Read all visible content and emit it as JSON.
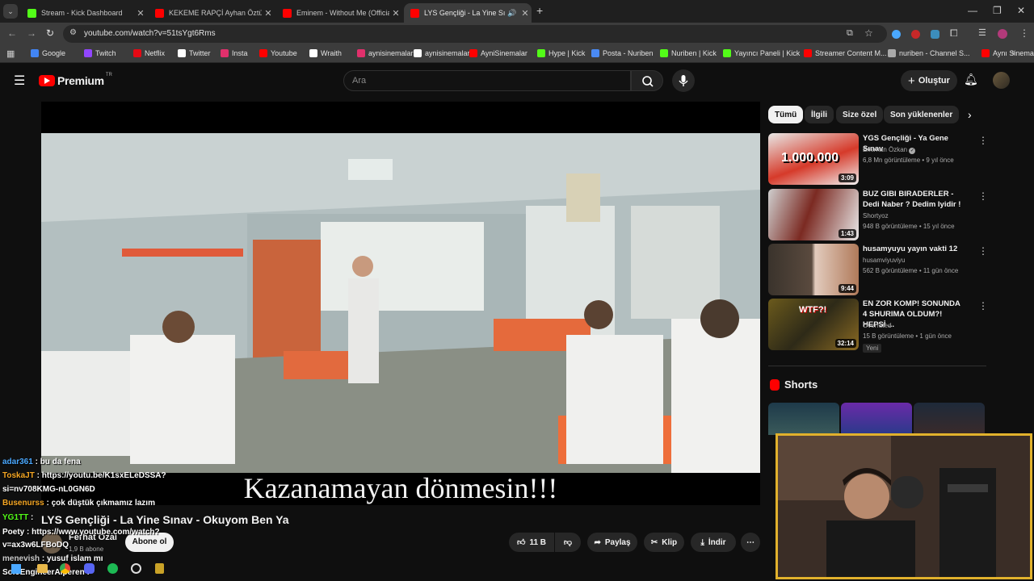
{
  "browser": {
    "tabs": [
      {
        "label": "Stream - Kick Dashboard",
        "icon": "kick-icon"
      },
      {
        "label": "KEKEME RAPÇİ Ayhan Öztürk Yo",
        "icon": "youtube-icon"
      },
      {
        "label": "Eminem - Without Me (Official",
        "icon": "youtube-icon"
      },
      {
        "label": "LYS Gençliği - La Yine Sınav",
        "icon": "youtube-icon"
      }
    ],
    "url": "youtube.com/watch?v=51tsYgt6Rms",
    "bookmarks": [
      {
        "label": "Google",
        "color": "#4285f4"
      },
      {
        "label": "Twitch",
        "color": "#9146ff"
      },
      {
        "label": "Netflix",
        "color": "#e50914"
      },
      {
        "label": "Twitter",
        "color": "#ffffff"
      },
      {
        "label": "Insta",
        "color": "#e1306c"
      },
      {
        "label": "Youtube",
        "color": "#ff0000"
      },
      {
        "label": "Wraith",
        "color": "#ffffff"
      },
      {
        "label": "aynisinemalar",
        "color": "#e1306c"
      },
      {
        "label": "aynisinemalar",
        "color": "#ffffff"
      },
      {
        "label": "AyniSinemalar",
        "color": "#ff0000"
      },
      {
        "label": "Hype | Kick",
        "color": "#53fc18"
      },
      {
        "label": "Posta - Nuriben",
        "color": "#4a8af4"
      },
      {
        "label": "Nuriben | Kick",
        "color": "#53fc18"
      },
      {
        "label": "Yayıncı Paneli | Kick",
        "color": "#53fc18"
      },
      {
        "label": "Streamer Content M...",
        "color": "#ff0000"
      },
      {
        "label": "nuriben - Channel S...",
        "color": "#aaaaaa"
      },
      {
        "label": "Aynı Sinemalar - Ça...",
        "color": "#ff0000"
      }
    ]
  },
  "youtube": {
    "logo": "Premium",
    "logo_tag": "TR",
    "search_placeholder": "Ara",
    "create_label": "Oluştur",
    "chips": [
      "Tümü",
      "İlgili",
      "Size özel",
      "Son yüklenenler"
    ],
    "video": {
      "subtitle": "Kazanamayan dönmesin!!!",
      "title": "LYS Gençliği - La Yine Sınav - Okuyom Ben Ya",
      "channel": "Ferhat Özal",
      "subscribers": "1,9 B abone",
      "subscribe_label": "Abone ol",
      "likes": "11 B",
      "share_label": "Paylaş",
      "clip_label": "Klip",
      "download_label": "İndir"
    },
    "related": [
      {
        "title": "YGS Gençliği - Ya Gene Sınav",
        "channel": "Emirhan Özkan",
        "verified": true,
        "meta": "6,8 Mn görüntüleme • 9 yıl önce",
        "duration": "3:09",
        "thumb_text": "1.000.000"
      },
      {
        "title": "BUZ GIBI BIRADERLER - Dedi Naber ? Dedim Iyidir !",
        "channel": "Shortyoz",
        "verified": false,
        "meta": "948 B görüntüleme • 15 yıl önce",
        "duration": "1:43"
      },
      {
        "title": "husamyuyu yayın vakti 12",
        "channel": "husamviyuviyu",
        "verified": false,
        "meta": "562 B görüntüleme • 11 gün önce",
        "duration": "9:44"
      },
      {
        "title": "EN ZOR KOMP! SONUNDA 4 SHURIMA OLDUM?! HEPSİ ...",
        "channel": "Overrated",
        "verified": false,
        "meta": "15 B görüntüleme • 1 gün önce",
        "duration": "32:14",
        "badge": "Yeni",
        "thumb_text": "WTF?!"
      }
    ],
    "shorts_label": "Shorts"
  },
  "chat": [
    {
      "user": "adar361",
      "text": ": bu da fena",
      "color": "#4aa8ff"
    },
    {
      "user": "ToskaJT",
      "text": ": https://youtu.be/K1sxELeDSSA?",
      "color": "#f5a623"
    },
    {
      "user": "",
      "text": "si=nv708KMG-nL0GN6D",
      "color": "#ffffff"
    },
    {
      "user": "Busenurss",
      "text": ": çok düştük çıkmamız lazım",
      "color": "#f5a623"
    },
    {
      "user": "YG1TT",
      "text": ":",
      "color": "#53fc18"
    },
    {
      "user": "Poety",
      "text": ": https://www.youtube.com/watch?",
      "color": "#ffffff"
    },
    {
      "user": "",
      "text": "v=ax3w6LFBoDQ",
      "color": "#ffffff"
    },
    {
      "user": "menevish",
      "text": ": yusuf islam mı",
      "color": "#cccccc"
    },
    {
      "user": "SoloEngineerAlperen",
      "text": ":",
      "color": "#ffffff"
    }
  ]
}
